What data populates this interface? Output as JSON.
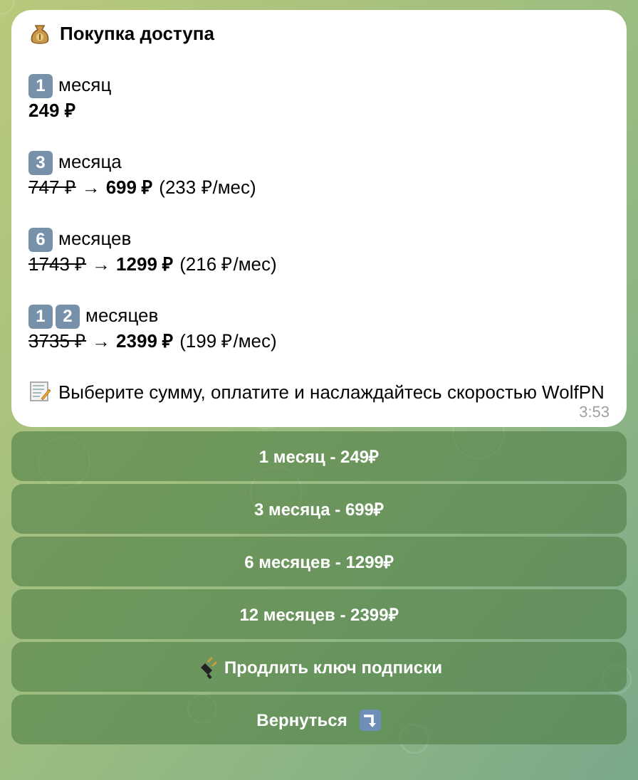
{
  "message": {
    "title": "Покупка доступа",
    "plans": [
      {
        "digits": [
          "1"
        ],
        "label": "месяц",
        "price": "249 ₽"
      },
      {
        "digits": [
          "3"
        ],
        "label": "месяца",
        "old_price": "747 ₽",
        "arrow": "→",
        "price": "699 ₽",
        "per_month": "(233 ₽/мес)"
      },
      {
        "digits": [
          "6"
        ],
        "label": "месяцев",
        "old_price": "1743 ₽",
        "arrow": "→",
        "price": "1299 ₽",
        "per_month": "(216 ₽/мес)"
      },
      {
        "digits": [
          "1",
          "2"
        ],
        "label": "месяцев",
        "old_price": "3735 ₽",
        "arrow": "→",
        "price": "2399 ₽",
        "per_month": "(199 ₽/мес)"
      }
    ],
    "footer": "Выберите сумму, оплатите и наслаждайтесь скоростью WolfPN",
    "time": "3:53"
  },
  "buttons": [
    {
      "label": "1 месяц - 249₽",
      "kind": "plain"
    },
    {
      "label": "3 месяца - 699₽",
      "kind": "plain"
    },
    {
      "label": "6 месяцев - 1299₽",
      "kind": "plain"
    },
    {
      "label": "12 месяцев - 2399₽",
      "kind": "plain"
    },
    {
      "label": "Продлить ключ подписки",
      "kind": "plug"
    },
    {
      "label": "Вернуться",
      "kind": "return"
    }
  ]
}
